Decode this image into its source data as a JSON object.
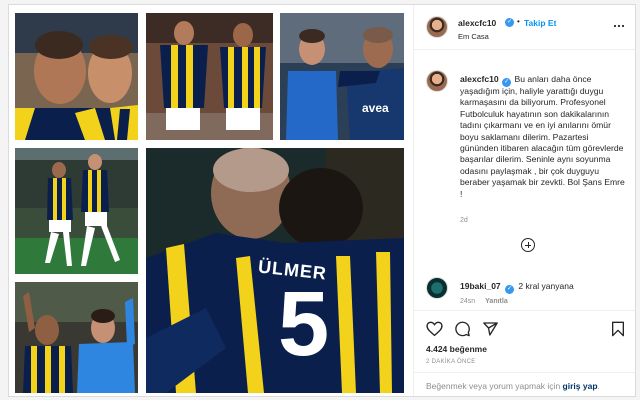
{
  "post": {
    "author": {
      "username": "alexcfc10",
      "verified": true,
      "follow_label": "Takip Et",
      "location": "Em Casa"
    },
    "caption": {
      "username": "alexcfc10",
      "text": "Bu anları daha önce yaşadığım için, haliyle yarattığı duygu karmaşasını da biliyorum. Profesyonel Futbolculuk hayatının son dakikalarının tadını çıkarmanı ve en iyi anılarını ömür boyu saklamanı dilerim. Pazartesi gününden itibaren alacağın tüm görevlerde başarılar dilerim. Seninle aynı soyunma odasını paylaşmak , bir çok duyguyu beraber yaşamak bir zevkti. Bol Şans Emre !",
      "age": "2d"
    },
    "comments": [
      {
        "username": "19baki_07",
        "verified": true,
        "text": "2 kral yanyana",
        "age": "24sn",
        "reply_label": "Yanıtla"
      }
    ],
    "likes": "4.424 beğenme",
    "timestamp": "2 DAKİKA ÖNCE",
    "add_comment": {
      "prefix": "Beğenmek veya yorum yapmak için",
      "link": "giriş yap",
      "suffix": "."
    },
    "jersey": {
      "brand": "avea",
      "name": "ÜLMER",
      "number": "5"
    }
  },
  "colors": {
    "navy": "#0b1f4d",
    "yellow": "#f2d21a",
    "link_blue": "#0095f6",
    "muted": "#8e8e8e"
  },
  "icons": [
    "verified-icon",
    "more-icon",
    "load-more-icon",
    "heart-icon",
    "comment-icon",
    "share-icon",
    "bookmark-icon"
  ]
}
